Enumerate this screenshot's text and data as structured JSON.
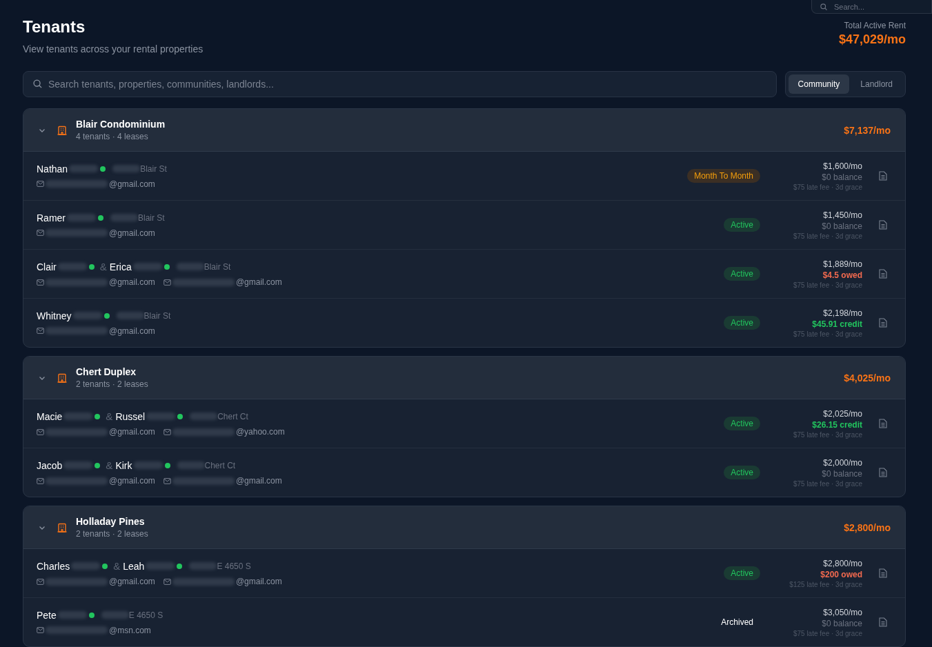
{
  "top_search": {
    "placeholder": "Search..."
  },
  "header": {
    "title": "Tenants",
    "subtitle": "View tenants across your rental properties",
    "total_label": "Total Active Rent",
    "total_value": "$47,029/mo"
  },
  "search": {
    "placeholder": "Search tenants, properties, communities, landlords..."
  },
  "group_by": [
    {
      "label": "Community",
      "selected": true
    },
    {
      "label": "Landlord",
      "selected": false
    }
  ],
  "communities": [
    {
      "name": "Blair Condominium",
      "meta": "4 tenants · 4 leases",
      "rent": "$7,137/mo",
      "expanded": true,
      "leases": [
        {
          "tenants": [
            {
              "first": "Nathan",
              "online": true,
              "email": "@gmail.com"
            }
          ],
          "street": "Blair St",
          "status": {
            "label": "Month To Month",
            "kind": "month"
          },
          "rent": "$1,600/mo",
          "balance": {
            "text": "$0 balance",
            "kind": "zero"
          },
          "terms": "$75 late fee · 3d grace"
        },
        {
          "tenants": [
            {
              "first": "Ramer",
              "online": true,
              "email": "@gmail.com"
            }
          ],
          "street": "Blair St",
          "status": {
            "label": "Active",
            "kind": "active"
          },
          "rent": "$1,450/mo",
          "balance": {
            "text": "$0 balance",
            "kind": "zero"
          },
          "terms": "$75 late fee · 3d grace"
        },
        {
          "tenants": [
            {
              "first": "Clair",
              "online": true,
              "email": "@gmail.com"
            },
            {
              "first": "Erica",
              "online": true,
              "email": "@gmail.com"
            }
          ],
          "joiner": "&",
          "street": "Blair St",
          "status": {
            "label": "Active",
            "kind": "active"
          },
          "rent": "$1,889/mo",
          "balance": {
            "text": "$4.5 owed",
            "kind": "owed"
          },
          "terms": "$75 late fee · 3d grace"
        },
        {
          "tenants": [
            {
              "first": "Whitney",
              "online": true,
              "email": "@gmail.com"
            }
          ],
          "street": "Blair St",
          "status": {
            "label": "Active",
            "kind": "active"
          },
          "rent": "$2,198/mo",
          "balance": {
            "text": "$45.91 credit",
            "kind": "credit"
          },
          "terms": "$75 late fee · 3d grace"
        }
      ]
    },
    {
      "name": "Chert Duplex",
      "meta": "2 tenants · 2 leases",
      "rent": "$4,025/mo",
      "expanded": true,
      "leases": [
        {
          "tenants": [
            {
              "first": "Macie",
              "online": true,
              "email": "@gmail.com"
            },
            {
              "first": "Russel",
              "online": true,
              "email": "@yahoo.com"
            }
          ],
          "joiner": "&",
          "street": "Chert Ct",
          "status": {
            "label": "Active",
            "kind": "active"
          },
          "rent": "$2,025/mo",
          "balance": {
            "text": "$26.15 credit",
            "kind": "credit"
          },
          "terms": "$75 late fee · 3d grace"
        },
        {
          "tenants": [
            {
              "first": "Jacob",
              "online": true,
              "email": "@gmail.com"
            },
            {
              "first": "Kirk",
              "online": true,
              "email": "@gmail.com"
            }
          ],
          "joiner": "&",
          "street": "Chert Ct",
          "status": {
            "label": "Active",
            "kind": "active"
          },
          "rent": "$2,000/mo",
          "balance": {
            "text": "$0 balance",
            "kind": "zero"
          },
          "terms": "$75 late fee · 3d grace"
        }
      ]
    },
    {
      "name": "Holladay Pines",
      "meta": "2 tenants · 2 leases",
      "rent": "$2,800/mo",
      "expanded": true,
      "leases": [
        {
          "tenants": [
            {
              "first": "Charles",
              "online": true,
              "email": "@gmail.com"
            },
            {
              "first": "Leah",
              "online": true,
              "email": "@gmail.com"
            }
          ],
          "joiner": "&",
          "street": "E 4650 S",
          "status": {
            "label": "Active",
            "kind": "active"
          },
          "rent": "$2,800/mo",
          "balance": {
            "text": "$200 owed",
            "kind": "owed"
          },
          "terms": "$125 late fee · 3d grace"
        },
        {
          "tenants": [
            {
              "first": "Pete",
              "online": true,
              "email": "@msn.com"
            }
          ],
          "street": "E 4650 S",
          "status": {
            "label": "Archived",
            "kind": "archived"
          },
          "rent": "$3,050/mo",
          "balance": {
            "text": "$0 balance",
            "kind": "zero"
          },
          "terms": "$75 late fee · 3d grace"
        }
      ]
    }
  ]
}
